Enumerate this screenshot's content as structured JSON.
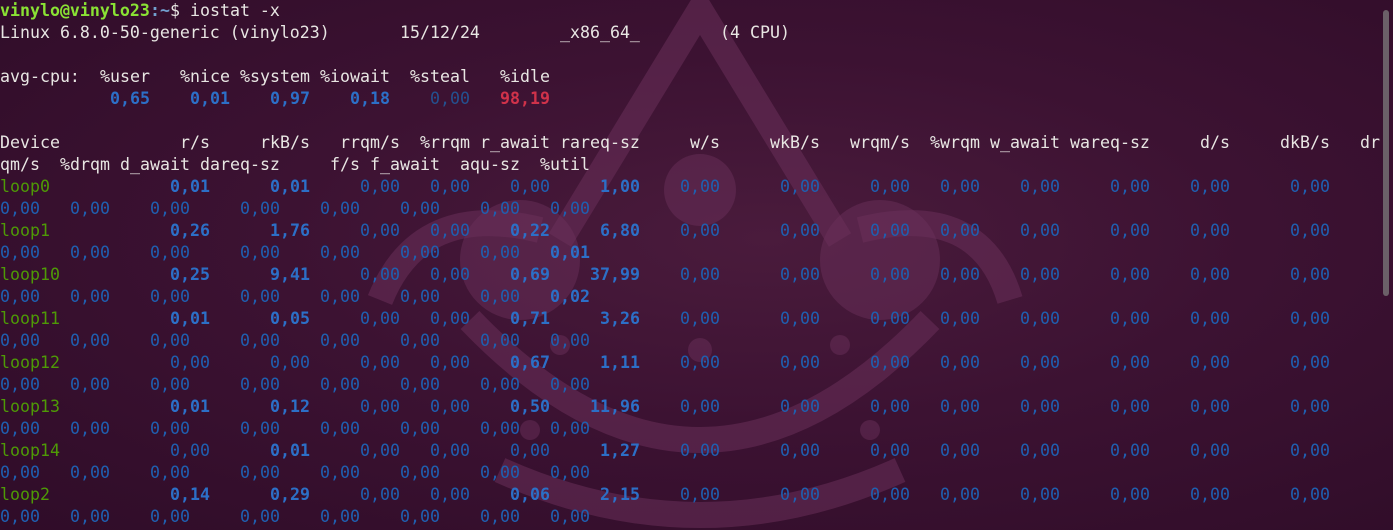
{
  "prompt": {
    "user_host": "vinylo@vinylo23",
    "path": ":~",
    "symbol": "$",
    "command": " iostat -x"
  },
  "sysinfo": {
    "kernel": "Linux 6.8.0-50-generic (vinylo23)",
    "date": "15/12/24",
    "arch": "_x86_64_",
    "cpus": "(4 CPU)"
  },
  "avgcpu": {
    "label": "avg-cpu:",
    "headers": [
      "%user",
      "%nice",
      "%system",
      "%iowait",
      "%steal",
      "%idle"
    ],
    "values": [
      "0,65",
      "0,01",
      "0,97",
      "0,18",
      "0,00",
      "98,19"
    ]
  },
  "device_headers_line1": [
    "Device",
    "r/s",
    "rkB/s",
    "rrqm/s",
    "%rrqm",
    "r_await",
    "rareq-sz",
    "w/s",
    "wkB/s",
    "wrqm/s",
    "%wrqm",
    "w_await",
    "wareq-sz",
    "d/s",
    "dkB/s",
    "dr"
  ],
  "device_headers_line2": [
    "qm/s",
    "%drqm",
    "d_await",
    "dareq-sz",
    "f/s",
    "f_await",
    "aqu-sz",
    "%util"
  ],
  "devices": [
    {
      "name": "loop0",
      "row1": [
        "0,01",
        "0,01",
        "0,00",
        "0,00",
        "0,00",
        "1,00",
        "0,00",
        "0,00",
        "0,00",
        "0,00",
        "0,00",
        "0,00",
        "0,00",
        "0,00"
      ],
      "row2": [
        "0,00",
        "0,00",
        "0,00",
        "0,00",
        "0,00",
        "0,00",
        "0,00",
        "0,00"
      ]
    },
    {
      "name": "loop1",
      "row1": [
        "0,26",
        "1,76",
        "0,00",
        "0,00",
        "0,22",
        "6,80",
        "0,00",
        "0,00",
        "0,00",
        "0,00",
        "0,00",
        "0,00",
        "0,00",
        "0,00"
      ],
      "row2": [
        "0,00",
        "0,00",
        "0,00",
        "0,00",
        "0,00",
        "0,00",
        "0,00",
        "0,01"
      ]
    },
    {
      "name": "loop10",
      "row1": [
        "0,25",
        "9,41",
        "0,00",
        "0,00",
        "0,69",
        "37,99",
        "0,00",
        "0,00",
        "0,00",
        "0,00",
        "0,00",
        "0,00",
        "0,00",
        "0,00"
      ],
      "row2": [
        "0,00",
        "0,00",
        "0,00",
        "0,00",
        "0,00",
        "0,00",
        "0,00",
        "0,02"
      ]
    },
    {
      "name": "loop11",
      "row1": [
        "0,01",
        "0,05",
        "0,00",
        "0,00",
        "0,71",
        "3,26",
        "0,00",
        "0,00",
        "0,00",
        "0,00",
        "0,00",
        "0,00",
        "0,00",
        "0,00"
      ],
      "row2": [
        "0,00",
        "0,00",
        "0,00",
        "0,00",
        "0,00",
        "0,00",
        "0,00",
        "0,00"
      ]
    },
    {
      "name": "loop12",
      "row1": [
        "0,00",
        "0,00",
        "0,00",
        "0,00",
        "0,67",
        "1,11",
        "0,00",
        "0,00",
        "0,00",
        "0,00",
        "0,00",
        "0,00",
        "0,00",
        "0,00"
      ],
      "row2": [
        "0,00",
        "0,00",
        "0,00",
        "0,00",
        "0,00",
        "0,00",
        "0,00",
        "0,00"
      ]
    },
    {
      "name": "loop13",
      "row1": [
        "0,01",
        "0,12",
        "0,00",
        "0,00",
        "0,50",
        "11,96",
        "0,00",
        "0,00",
        "0,00",
        "0,00",
        "0,00",
        "0,00",
        "0,00",
        "0,00"
      ],
      "row2": [
        "0,00",
        "0,00",
        "0,00",
        "0,00",
        "0,00",
        "0,00",
        "0,00",
        "0,00"
      ]
    },
    {
      "name": "loop14",
      "row1": [
        "0,00",
        "0,01",
        "0,00",
        "0,00",
        "0,00",
        "1,27",
        "0,00",
        "0,00",
        "0,00",
        "0,00",
        "0,00",
        "0,00",
        "0,00",
        "0,00"
      ],
      "row2": [
        "0,00",
        "0,00",
        "0,00",
        "0,00",
        "0,00",
        "0,00",
        "0,00",
        "0,00"
      ]
    },
    {
      "name": "loop2",
      "row1": [
        "0,14",
        "0,29",
        "0,00",
        "0,00",
        "0,06",
        "2,15",
        "0,00",
        "0,00",
        "0,00",
        "0,00",
        "0,00",
        "0,00",
        "0,00",
        "0,00"
      ],
      "row2": [
        "0,00",
        "0,00",
        "0,00",
        "0,00",
        "0,00",
        "0,00",
        "0,00",
        "0,00"
      ]
    }
  ],
  "colors": {
    "background": "#3c1232",
    "prompt_user": "#8ae234",
    "prompt_path": "#729fcf",
    "device": "#4e9a06",
    "value": "#1f5fb0",
    "idle": "#d0324a"
  },
  "icons": {
    "wallpaper": "ubuntu-crown-wallpaper-icon",
    "scrollbar": "scrollbar-thumb"
  }
}
